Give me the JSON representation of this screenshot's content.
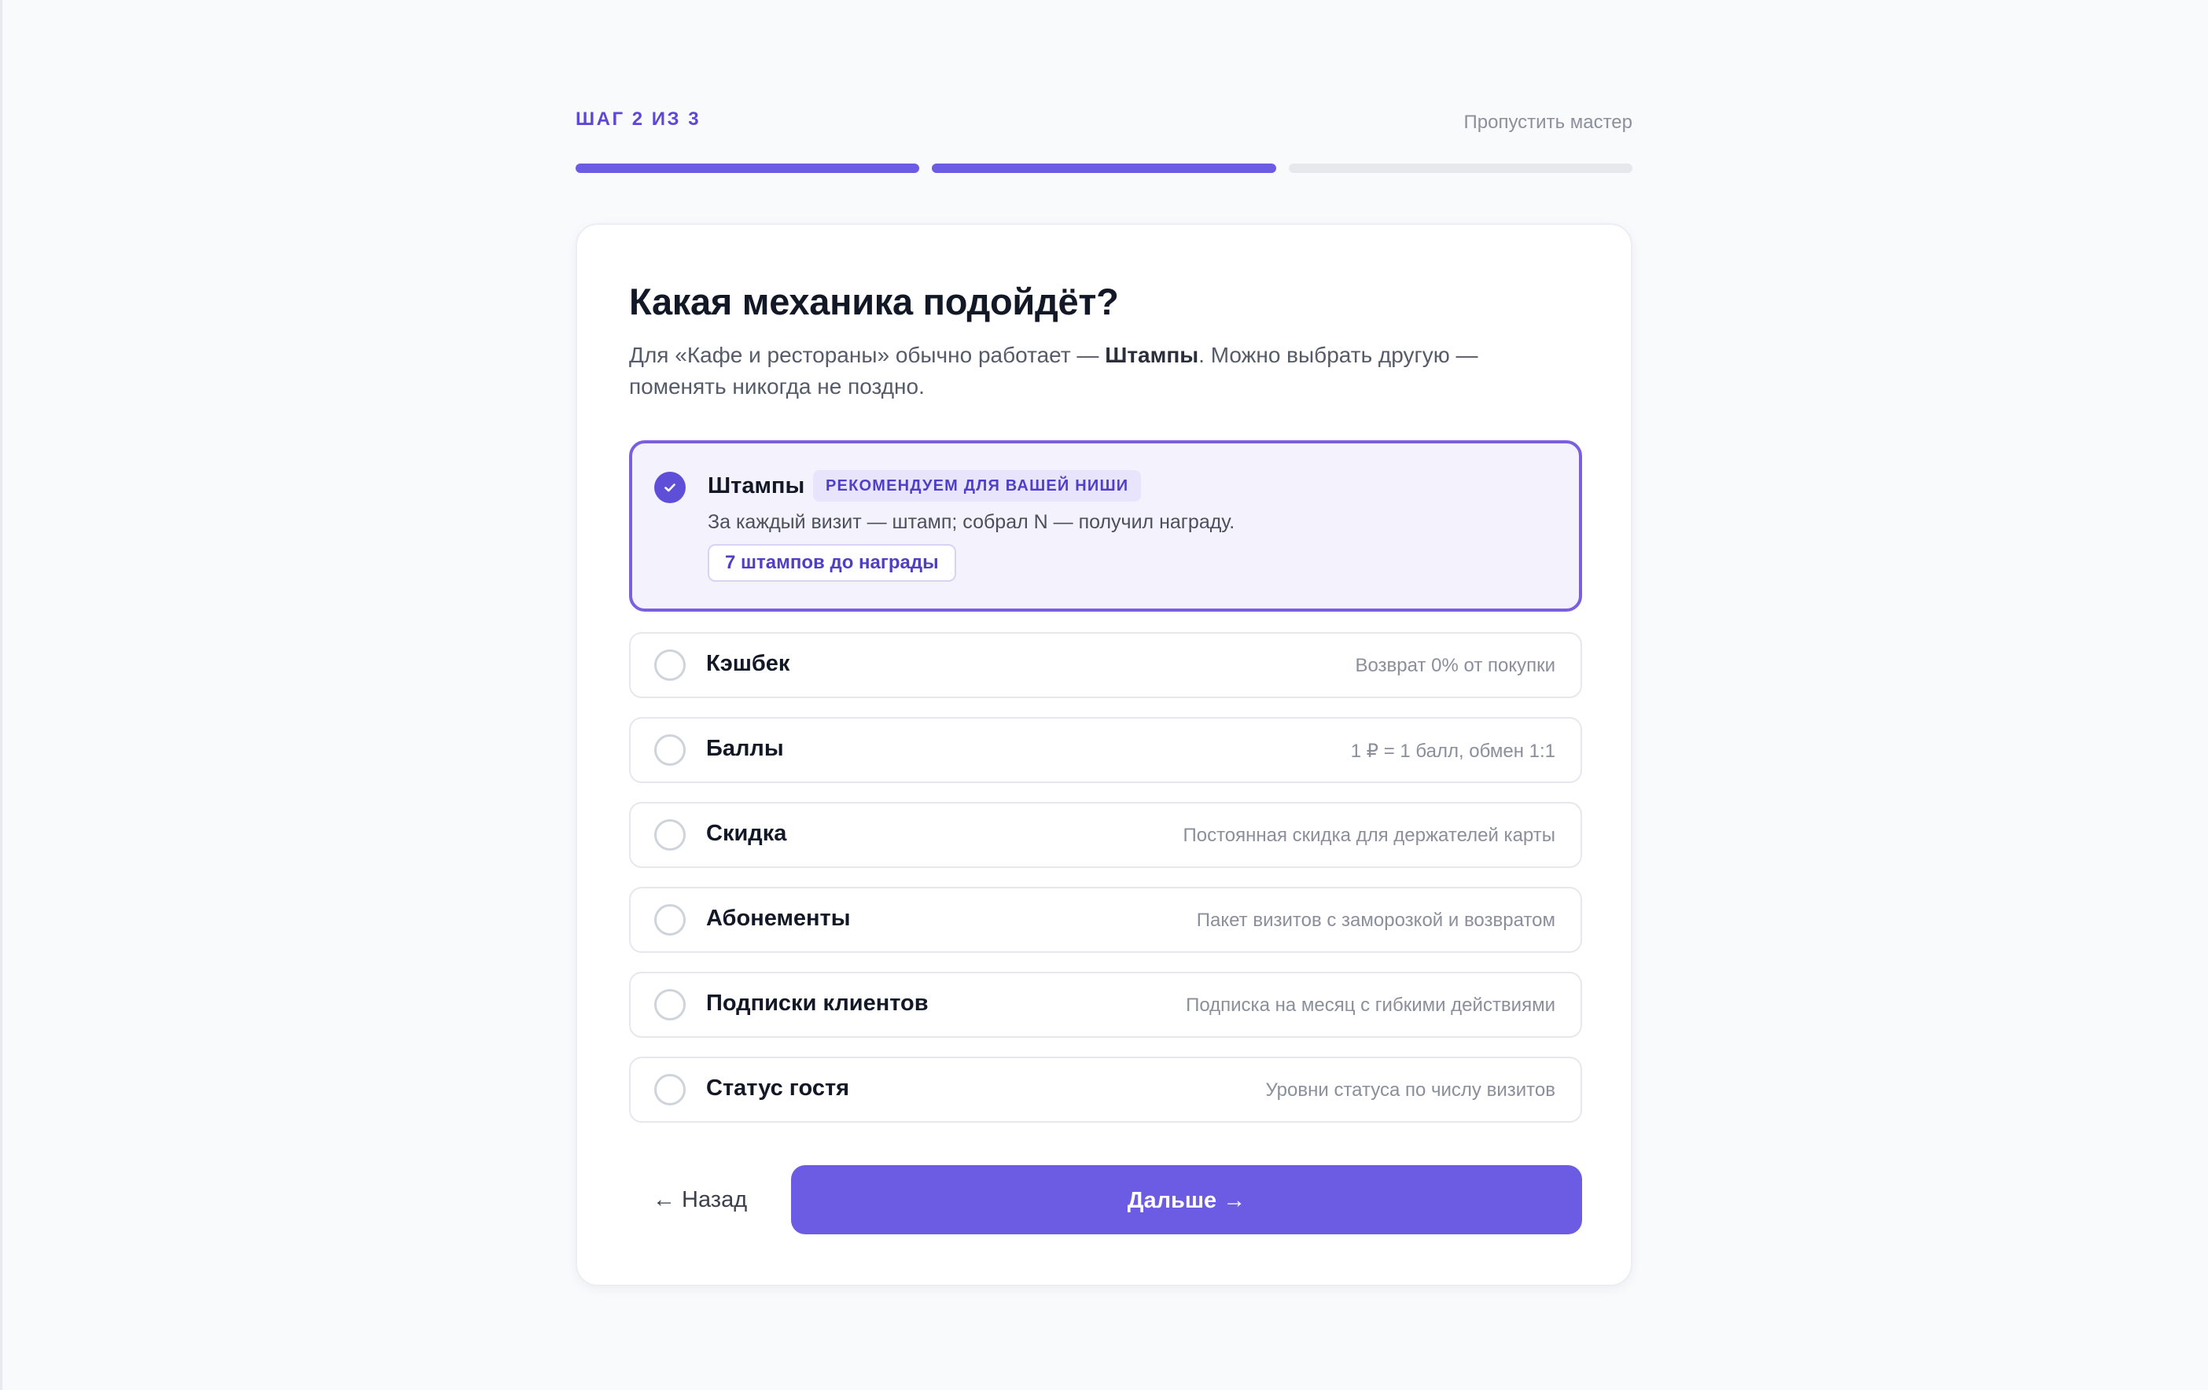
{
  "wizard": {
    "step_label": "ШАГ 2 ИЗ 3",
    "skip_label": "Пропустить мастер",
    "progress": {
      "current_step": 2,
      "total_steps": 3
    }
  },
  "card": {
    "title": "Какая механика подойдёт?",
    "desc_before": "Для «Кафе и рестораны» обычно работает — ",
    "desc_bold": "Штампы",
    "desc_after": ". Можно выбрать другую — поменять никогда не поздно."
  },
  "options": [
    {
      "title": "Штампы",
      "badge": "РЕКОМЕНДУЕМ ДЛЯ ВАШЕЙ НИШИ",
      "desc": "За каждый визит — штамп; собрал N — получил награду.",
      "pill": "7 штампов до награды",
      "selected": true
    },
    {
      "title": "Кэшбек",
      "hint": "Возврат 0% от покупки",
      "selected": false
    },
    {
      "title": "Баллы",
      "hint": "1 ₽ = 1 балл, обмен 1:1",
      "selected": false
    },
    {
      "title": "Скидка",
      "hint": "Постоянная скидка для держателей карты",
      "selected": false
    },
    {
      "title": "Абонементы",
      "hint": "Пакет визитов с заморозкой и возвратом",
      "selected": false
    },
    {
      "title": "Подписки клиентов",
      "hint": "Подписка на месяц с гибкими действиями",
      "selected": false
    },
    {
      "title": "Статус гостя",
      "hint": "Уровни статуса по числу визитов",
      "selected": false
    }
  ],
  "actions": {
    "back_label": "← Назад",
    "next_label": "Дальше →"
  },
  "colors": {
    "accent": "#6b5ce3",
    "accent_text": "#5b48d9",
    "selected_bg": "#f4f2fd",
    "selected_border": "#7a5fe0"
  }
}
